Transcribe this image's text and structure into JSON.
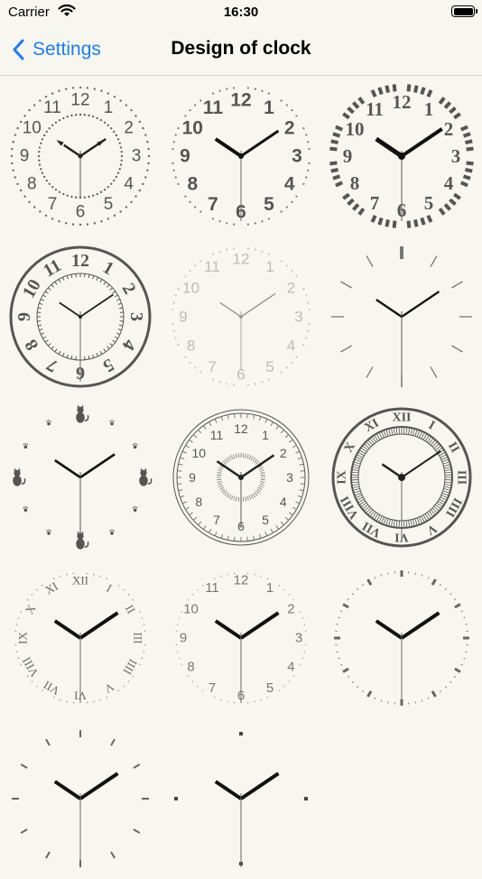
{
  "status_bar": {
    "carrier": "Carrier",
    "time": "16:30",
    "wifi_icon": "wifi-icon",
    "battery_icon": "battery-icon"
  },
  "nav": {
    "back_label": "Settings",
    "back_icon": "chevron-left-icon",
    "title": "Design of clock"
  },
  "clocks": [
    {
      "name": "dotted-circle-clock"
    },
    {
      "name": "bold-numeral-clock"
    },
    {
      "name": "stencil-numeral-clock"
    },
    {
      "name": "ringed-art-deco-clock"
    },
    {
      "name": "light-gray-numeral-clock"
    },
    {
      "name": "minimal-tick-clock"
    },
    {
      "name": "cat-clock"
    },
    {
      "name": "classic-thin-ring-clock"
    },
    {
      "name": "roman-ring-clock"
    },
    {
      "name": "rotated-roman-clock"
    },
    {
      "name": "gray-arabic-clock"
    },
    {
      "name": "dash-tick-clock"
    },
    {
      "name": "dash-tick-bold-clock"
    },
    {
      "name": "four-dot-clock"
    }
  ],
  "numerals": {
    "arabic": [
      "12",
      "1",
      "2",
      "3",
      "4",
      "5",
      "6",
      "7",
      "8",
      "9",
      "10",
      "11"
    ],
    "roman": [
      "XII",
      "I",
      "II",
      "III",
      "IIII",
      "V",
      "VI",
      "VII",
      "VIII",
      "IX",
      "X",
      "XI"
    ]
  },
  "colors": {
    "accent": "#1a7cf5",
    "background": "#f7f7f0",
    "clock_dark": "#555555",
    "clock_light": "#bbbbbb"
  }
}
